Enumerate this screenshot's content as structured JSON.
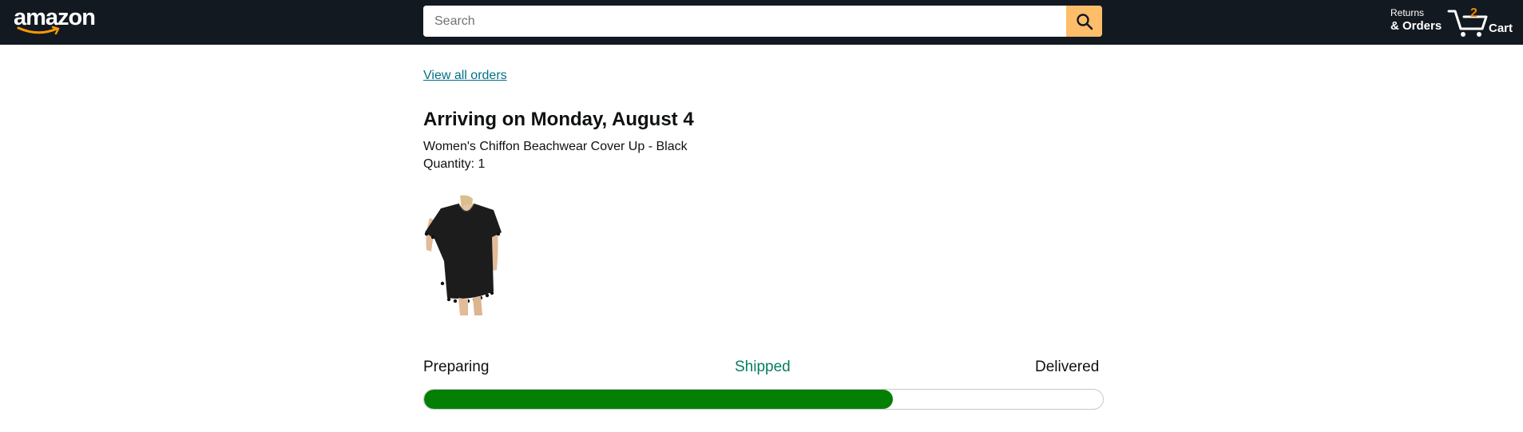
{
  "header": {
    "logo_text": "amazon",
    "search": {
      "placeholder": "Search",
      "value": ""
    },
    "returns_line1": "Returns",
    "returns_line2": "& Orders",
    "cart_count": "2",
    "cart_label": "Cart"
  },
  "order": {
    "view_all_link": "View all orders",
    "arriving_title": "Arriving on Monday, August 4",
    "item_name": "Women's Chiffon Beachwear Cover Up - Black",
    "quantity": "Quantity: 1",
    "product_image": "black-tassel-beach-coverup-dress"
  },
  "tracking": {
    "steps": [
      "Preparing",
      "Shipped",
      "Delivered"
    ],
    "current_step": "Shipped",
    "progress_percent": 69
  },
  "colors": {
    "header_bg": "#131921",
    "search_button": "#febd69",
    "cart_count": "#f08804",
    "link": "#007185",
    "shipped_text": "#067d62",
    "progress_fill": "#038003"
  }
}
